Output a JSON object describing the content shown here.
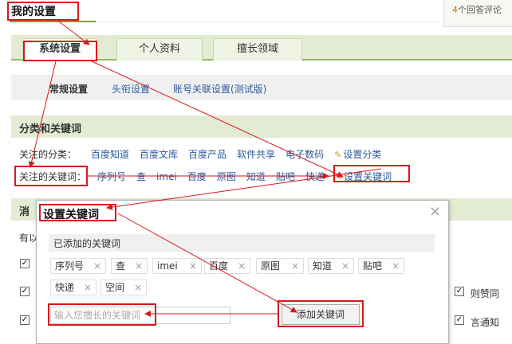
{
  "header": {
    "title": "我的设置",
    "answers_count": "4",
    "answers_text": "个回答评论"
  },
  "tabs": [
    {
      "label": "系统设置"
    },
    {
      "label": "个人资料"
    },
    {
      "label": "擅长领域"
    }
  ],
  "subnav": {
    "items": [
      {
        "label": "常规设置"
      },
      {
        "label": "头衔设置"
      },
      {
        "label": "账号关联设置(测试版)"
      }
    ]
  },
  "sections": {
    "category": "分类和关键词",
    "message_partial": "消"
  },
  "categories": {
    "label": "关注的分类：",
    "items": [
      "百度知道",
      "百度文库",
      "百度产品",
      "软件共享",
      "电子数码"
    ],
    "edit": "设置分类"
  },
  "keywords": {
    "label": "关注的关键词：",
    "items": [
      "序列号",
      "查",
      "imei",
      "百度",
      "原图",
      "知道",
      "贴吧",
      "快递"
    ],
    "edit": "设置关键词"
  },
  "background": {
    "row_partial": "有以",
    "right_text_1": "则赞同",
    "right_text_2": "言通知"
  },
  "dialog": {
    "title": "设置关键词",
    "close_glyph": "✕",
    "added_label": "已添加的关键词",
    "tags": [
      "序列号",
      "查",
      "imei",
      "百度",
      "原图",
      "知道",
      "贴吧",
      "快递",
      "空间"
    ],
    "tag_close": "×",
    "input_placeholder": "输入您擅长的关键词",
    "add_button": "添加关键词"
  },
  "colors": {
    "annotation_red": "#d9161a",
    "header_green": "#e3ecd3",
    "link_blue": "#2a5a9c"
  }
}
